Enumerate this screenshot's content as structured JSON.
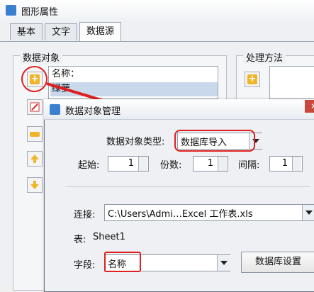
{
  "window": {
    "title": "图形属性"
  },
  "tabs": [
    {
      "label": "基本"
    },
    {
      "label": "文字"
    },
    {
      "label": "数据源",
      "active": true
    }
  ],
  "data_objects": {
    "group_label": "数据对象",
    "items": [
      {
        "label": "名称："
      },
      {
        "label": "绿萝",
        "selected": true
      }
    ]
  },
  "processing": {
    "group_label": "处理方法"
  },
  "dialog": {
    "title": "数据对象管理",
    "type_label": "数据对象类型:",
    "type_value": "数据库导入",
    "start_label": "起始:",
    "start_value": "1",
    "copies_label": "份数:",
    "copies_value": "1",
    "interval_label": "间隔:",
    "interval_value": "1",
    "connection_label": "连接:",
    "connection_value": "C:\\Users\\Admi…Excel 工作表.xls",
    "table_label": "表:",
    "table_value": "Sheet1",
    "field_label": "字段:",
    "field_value": "名称",
    "db_settings_button": "数据库设置"
  },
  "colors": {
    "annotation": "#e02020",
    "accent": "#f0b429"
  }
}
